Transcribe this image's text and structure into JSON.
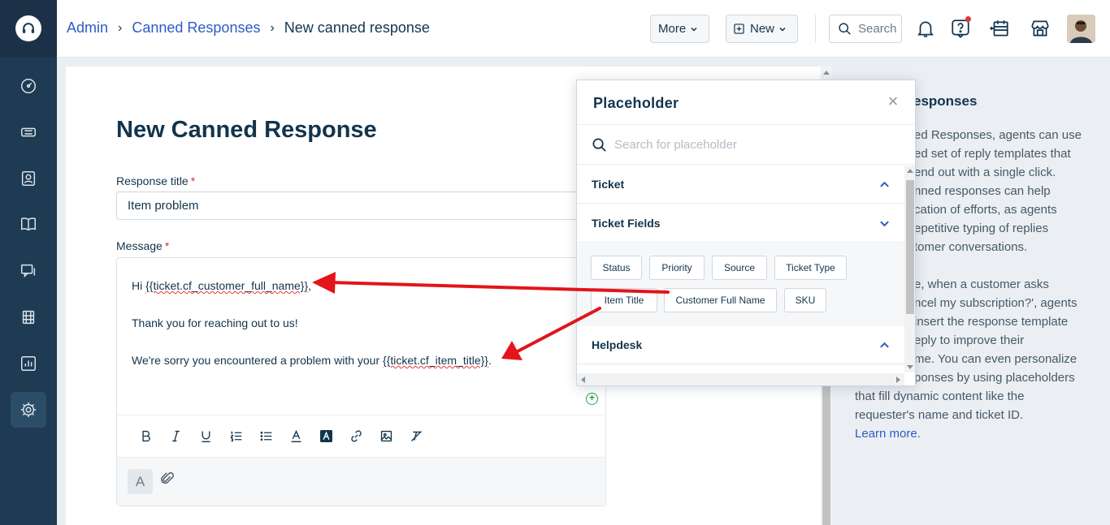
{
  "breadcrumb": {
    "items": [
      "Admin",
      "Canned Responses"
    ],
    "current": "New canned response",
    "separator": "›"
  },
  "header": {
    "more_label": "More",
    "new_label": "New",
    "search_placeholder": "Search",
    "notification_dot_color": "#e43538"
  },
  "sidebar": {
    "items": [
      {
        "icon": "dashboard-icon"
      },
      {
        "icon": "tickets-icon"
      },
      {
        "icon": "contacts-icon"
      },
      {
        "icon": "solutions-icon"
      },
      {
        "icon": "forums-icon"
      },
      {
        "icon": "team-huddle-icon"
      },
      {
        "icon": "reports-icon"
      },
      {
        "icon": "admin-settings-icon",
        "active": true
      }
    ]
  },
  "form": {
    "page_title": "New Canned Response",
    "response_title_label": "Response title",
    "response_title_value": "Item problem",
    "message_label": "Message",
    "required_mark": "*",
    "message": {
      "line1_prefix": "Hi ",
      "line1_placeholder": "{{ticket.cf_customer_full_name}}",
      "line1_suffix": ",",
      "line2": "Thank you for reaching out to us!",
      "line3_prefix": "We're sorry you encountered a problem with your ",
      "line3_placeholder": "{{ticket.cf_item_title}}",
      "line3_suffix": "."
    },
    "toolbar_buttons": [
      "bold",
      "italic",
      "underline",
      "numbered-list",
      "bullet-list",
      "text-color",
      "highlight",
      "link",
      "image",
      "clear-format"
    ]
  },
  "placeholder_popover": {
    "title": "Placeholder",
    "search_placeholder": "Search for placeholder",
    "sections": {
      "ticket": "Ticket",
      "ticket_fields": "Ticket Fields",
      "helpdesk": "Helpdesk"
    },
    "chips": [
      "Status",
      "Priority",
      "Source",
      "Ticket Type",
      "Item Title",
      "Customer Full Name",
      "SKU"
    ]
  },
  "help_panel": {
    "title_fragment": "esponses",
    "lines_p1": [
      "ed Responses, agents can use",
      "ed set of reply templates that",
      "end out with a single click.",
      "nned responses can help",
      "cation of efforts, as agents",
      "epetitive typing of replies",
      "tomer conversations."
    ],
    "lines_p2": [
      "e, when a customer asks",
      "ncel my subscription?', agents",
      "insert the response template",
      "eply to improve their",
      "me. You can even personalize",
      "ponses by using placeholders",
      "that fill dynamic content like the",
      "requester's name and ticket ID."
    ],
    "learn_more": "Learn more."
  },
  "colors": {
    "sidebar_bg": "#1f3b53",
    "link_blue": "#2c5cc5",
    "text_dark": "#12344d",
    "annotation_arrow": "#e3141b",
    "required_red": "#d72d30"
  }
}
